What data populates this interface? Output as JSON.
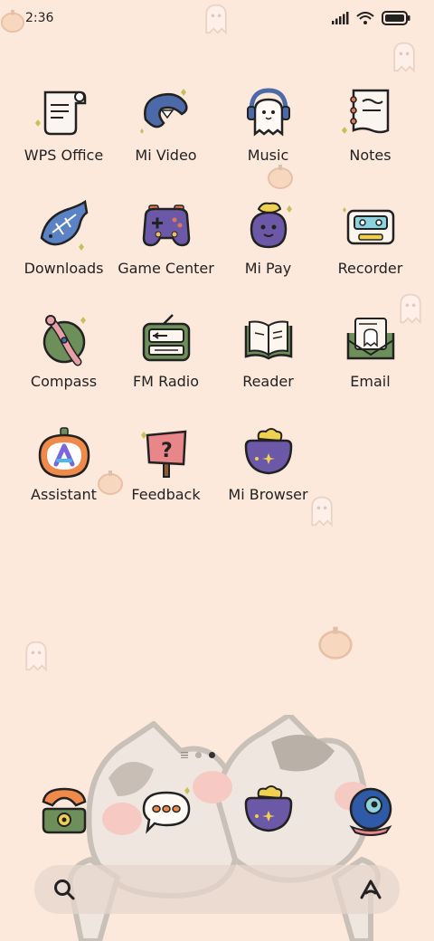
{
  "status_bar": {
    "time": "2:36",
    "icons": [
      "signal-icon",
      "wifi-icon",
      "battery-icon"
    ]
  },
  "apps": [
    {
      "label": "WPS Office",
      "icon": "wps-office-icon"
    },
    {
      "label": "Mi Video",
      "icon": "mi-video-icon"
    },
    {
      "label": "Music",
      "icon": "music-icon"
    },
    {
      "label": "Notes",
      "icon": "notes-icon"
    },
    {
      "label": "Downloads",
      "icon": "downloads-icon"
    },
    {
      "label": "Game Center",
      "icon": "game-center-icon"
    },
    {
      "label": "Mi Pay",
      "icon": "mi-pay-icon"
    },
    {
      "label": "Recorder",
      "icon": "recorder-icon"
    },
    {
      "label": "Compass",
      "icon": "compass-icon"
    },
    {
      "label": "FM Radio",
      "icon": "fm-radio-icon"
    },
    {
      "label": "Reader",
      "icon": "reader-icon"
    },
    {
      "label": "Email",
      "icon": "email-icon"
    },
    {
      "label": "Assistant",
      "icon": "assistant-icon"
    },
    {
      "label": "Feedback",
      "icon": "feedback-icon"
    },
    {
      "label": "Mi Browser",
      "icon": "mi-browser-icon"
    }
  ],
  "page_indicator": {
    "current": 2,
    "total": 2
  },
  "dock": [
    {
      "icon": "phone-icon"
    },
    {
      "icon": "messaging-icon"
    },
    {
      "icon": "browser-cauldron-icon"
    },
    {
      "icon": "camera-icon"
    }
  ],
  "search_bar": {
    "placeholder": ""
  },
  "colors": {
    "background": "#fde9dc",
    "text": "#222222"
  }
}
